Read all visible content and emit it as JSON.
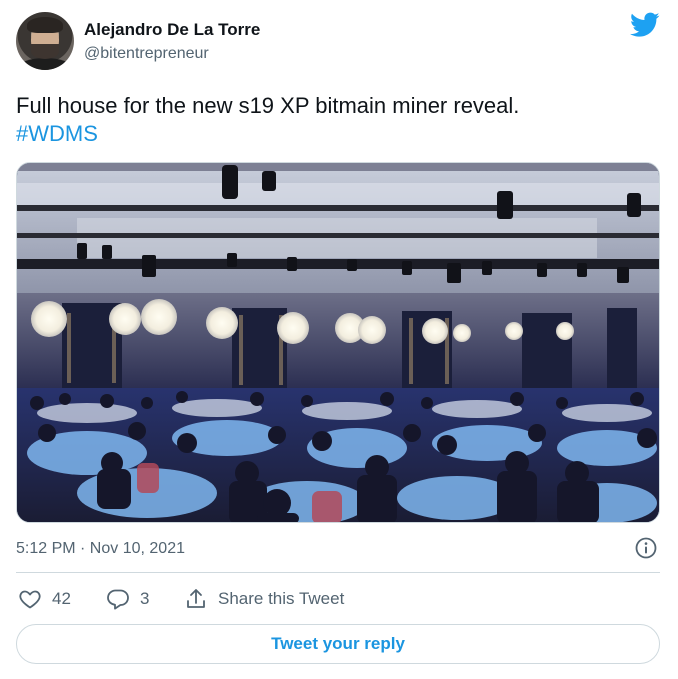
{
  "author": {
    "name": "Alejandro De La Torre",
    "handle": "@bitentrepreneur"
  },
  "tweet": {
    "text": "Full house for the new s19 XP bitmain miner reveal.",
    "hashtag": "#WDMS",
    "timestamp": "5:12 PM · Nov 10, 2021"
  },
  "actions": {
    "likes": "42",
    "replies": "3",
    "share_label": "Share this Tweet"
  },
  "reply_button": "Tweet your reply",
  "colors": {
    "accent": "#1b95e0",
    "muted": "#536471",
    "border": "#cfd9de"
  },
  "icons": {
    "brand": "twitter-bird-icon",
    "info": "info-icon",
    "like": "heart-icon",
    "reply": "reply-bubble-icon",
    "share": "share-icon"
  }
}
